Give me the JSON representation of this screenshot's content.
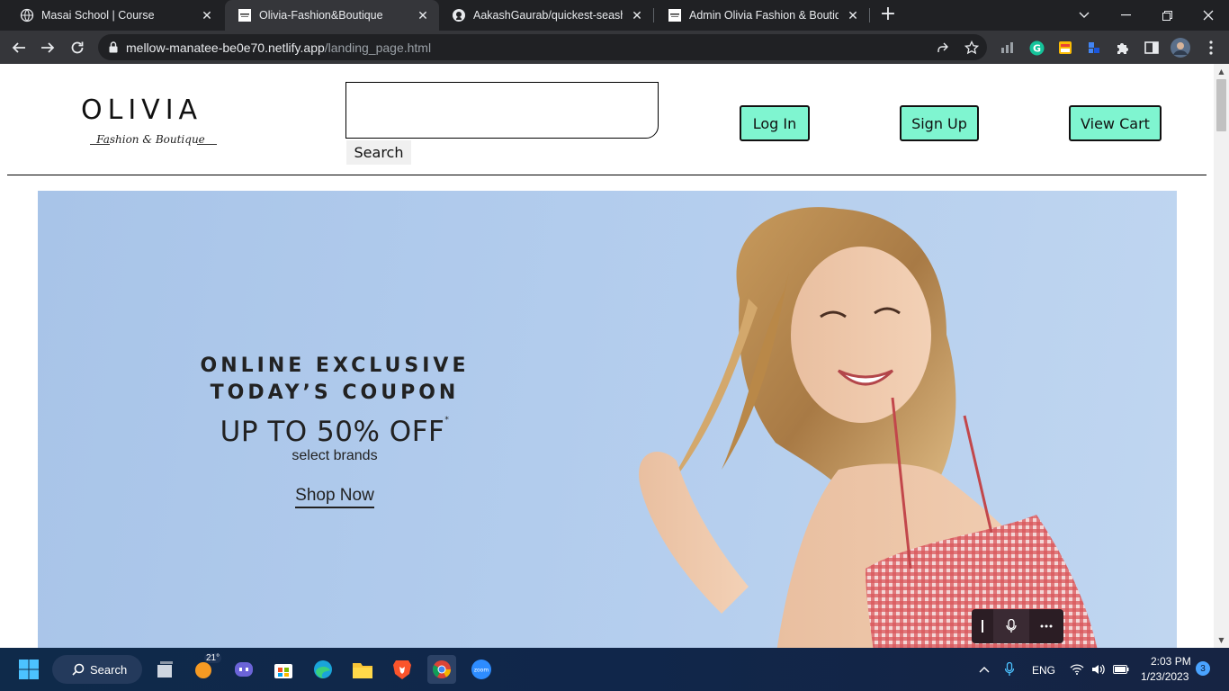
{
  "browser": {
    "tabs": [
      {
        "title": "Masai School | Course",
        "icon": "globe-icon",
        "active": false
      },
      {
        "title": "Olivia-Fashion&Boutique",
        "icon": "olivia-favicon",
        "active": true
      },
      {
        "title": "AakashGaurab/quickest-seashore",
        "icon": "github-icon",
        "active": false
      },
      {
        "title": "Admin Olivia Fashion & Boutique",
        "icon": "olivia-favicon",
        "active": false
      }
    ],
    "url_host": "mellow-manatee-be0e70.netlify.app",
    "url_path": "/landing_page.html"
  },
  "header": {
    "logo_brand": "OLIVIA",
    "logo_sub": "Fashion & Boutique",
    "search_value": "",
    "search_label": "Search",
    "login_label": "Log In",
    "signup_label": "Sign Up",
    "cart_label": "View Cart",
    "button_color": "#7ff5d0"
  },
  "hero": {
    "line1": "ONLINE EXCLUSIVE",
    "line2": "TODAY’S COUPON",
    "offer": "UP TO 50% OFF",
    "offer_mark": "*",
    "sub": "select brands",
    "cta": "Shop Now",
    "background_color": "#adc8ec"
  },
  "taskbar": {
    "search_label": "Search",
    "weather": "21°",
    "language": "ENG",
    "time": "2:03 PM",
    "date": "1/23/2023",
    "notifications": "3"
  }
}
